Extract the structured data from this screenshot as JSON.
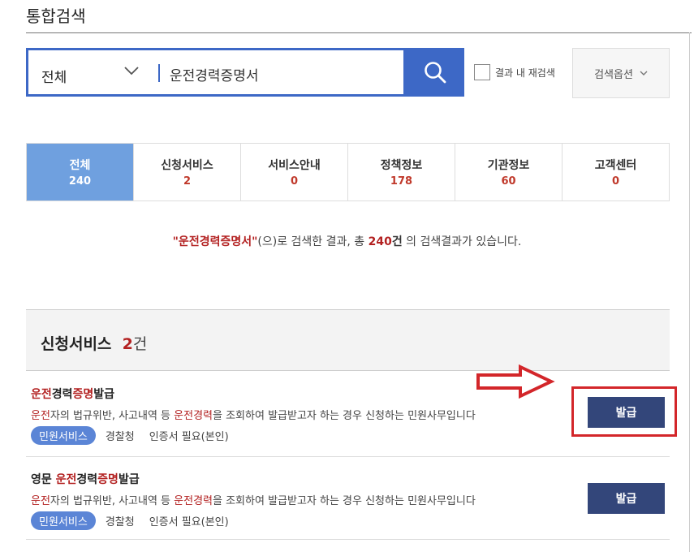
{
  "page": {
    "title": "통합검색"
  },
  "search": {
    "scope": "전체",
    "query": "운전경력증명서",
    "research_label": "결과 내 재검색",
    "options_label": "검색옵션"
  },
  "tabs": [
    {
      "label": "전체",
      "count": "240"
    },
    {
      "label": "신청서비스",
      "count": "2"
    },
    {
      "label": "서비스안내",
      "count": "0"
    },
    {
      "label": "정책정보",
      "count": "178"
    },
    {
      "label": "기관정보",
      "count": "60"
    },
    {
      "label": "고객센터",
      "count": "0"
    }
  ],
  "summary": {
    "keyword": "\"운전경력증명서\"",
    "text1": "(으)로 검색한 결과, 총 ",
    "total": "240",
    "unit": "건",
    "text2": " 의 검색결과가 있습니다."
  },
  "section": {
    "title": "신청서비스",
    "count": "2",
    "unit": "건"
  },
  "results": [
    {
      "title_parts": [
        "",
        "운전",
        "경력",
        "증명",
        "발급"
      ],
      "desc_parts": [
        "운전",
        "자의 법규위반, 사고내역 등 ",
        "운전경력",
        "을 조회하여 발급받고자 하는 경우 신청하는 민원사무입니다"
      ],
      "badge": "민원서비스",
      "agency": "경찰청",
      "cert": "인증서 필요(본인)",
      "button": "발급"
    },
    {
      "title_parts": [
        "영문 ",
        "운전",
        "경력",
        "증명",
        "발급"
      ],
      "desc_parts": [
        "운전",
        "자의 법규위반, 사고내역 등 ",
        "운전경력",
        "을 조회하여 발급받고자 하는 경우 신청하는 민원사무입니다"
      ],
      "badge": "민원서비스",
      "agency": "경찰청",
      "cert": "인증서 필요(본인)",
      "button": "발급"
    }
  ],
  "colors": {
    "accent": "#3d68c6",
    "active_tab": "#6fa0df",
    "highlight_red": "#d3262a",
    "button": "#33467a",
    "keyword": "#b32121"
  },
  "icons": [
    "chevron-down-icon",
    "search-icon",
    "arrow-right-icon"
  ]
}
